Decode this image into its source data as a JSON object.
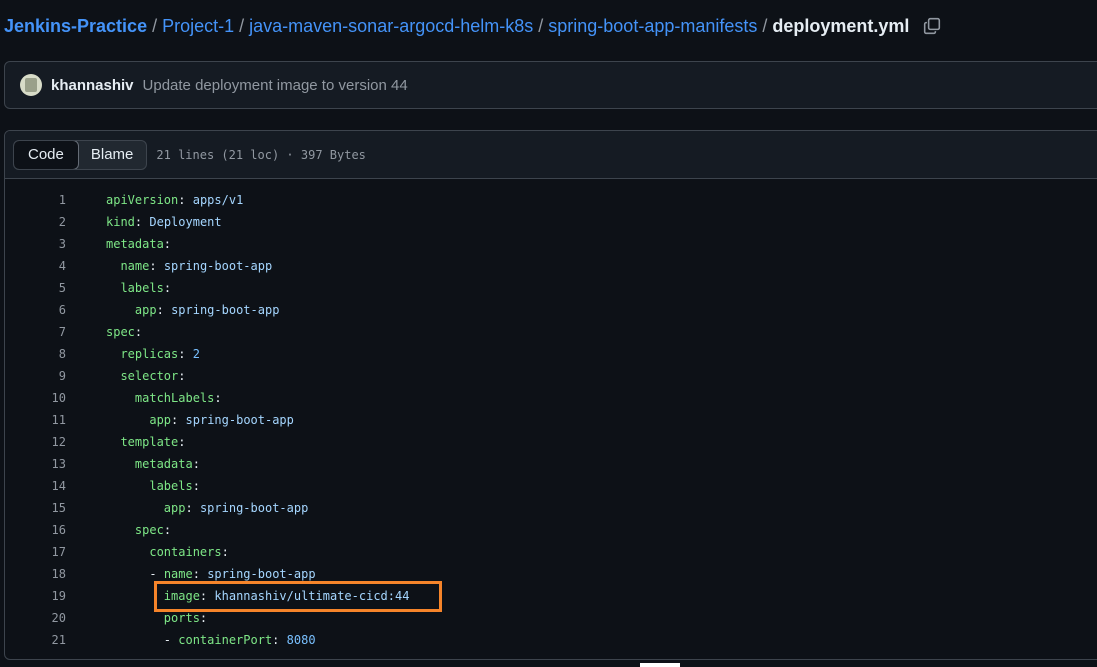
{
  "breadcrumb": {
    "repo": "Jenkins-Practice",
    "path": [
      "Project-1",
      "java-maven-sonar-argocd-helm-k8s",
      "spring-boot-app-manifests"
    ],
    "current": "deployment.yml",
    "copy_icon": "copy-icon"
  },
  "commit": {
    "author": "khannashiv",
    "message": "Update deployment image to version 44"
  },
  "file": {
    "tabs": [
      "Code",
      "Blame"
    ],
    "active_tab": "Code",
    "info": "21 lines (21 loc) · 397 Bytes"
  },
  "code_lines": [
    {
      "n": "1",
      "indent": "",
      "key": "apiVersion",
      "value": "apps/v1",
      "dash": false
    },
    {
      "n": "2",
      "indent": "",
      "key": "kind",
      "value": "Deployment",
      "dash": false
    },
    {
      "n": "3",
      "indent": "",
      "key": "metadata",
      "value": "",
      "dash": false
    },
    {
      "n": "4",
      "indent": "  ",
      "key": "name",
      "value": "spring-boot-app",
      "dash": false
    },
    {
      "n": "5",
      "indent": "  ",
      "key": "labels",
      "value": "",
      "dash": false
    },
    {
      "n": "6",
      "indent": "    ",
      "key": "app",
      "value": "spring-boot-app",
      "dash": false
    },
    {
      "n": "7",
      "indent": "",
      "key": "spec",
      "value": "",
      "dash": false
    },
    {
      "n": "8",
      "indent": "  ",
      "key": "replicas",
      "value": "2",
      "dash": false,
      "numeric": true
    },
    {
      "n": "9",
      "indent": "  ",
      "key": "selector",
      "value": "",
      "dash": false
    },
    {
      "n": "10",
      "indent": "    ",
      "key": "matchLabels",
      "value": "",
      "dash": false
    },
    {
      "n": "11",
      "indent": "      ",
      "key": "app",
      "value": "spring-boot-app",
      "dash": false
    },
    {
      "n": "12",
      "indent": "  ",
      "key": "template",
      "value": "",
      "dash": false
    },
    {
      "n": "13",
      "indent": "    ",
      "key": "metadata",
      "value": "",
      "dash": false
    },
    {
      "n": "14",
      "indent": "      ",
      "key": "labels",
      "value": "",
      "dash": false
    },
    {
      "n": "15",
      "indent": "        ",
      "key": "app",
      "value": "spring-boot-app",
      "dash": false
    },
    {
      "n": "16",
      "indent": "    ",
      "key": "spec",
      "value": "",
      "dash": false
    },
    {
      "n": "17",
      "indent": "      ",
      "key": "containers",
      "value": "",
      "dash": false
    },
    {
      "n": "18",
      "indent": "      ",
      "key": "name",
      "value": "spring-boot-app",
      "dash": true
    },
    {
      "n": "19",
      "indent": "        ",
      "key": "image",
      "value": "khannashiv/ultimate-cicd:44",
      "dash": false
    },
    {
      "n": "20",
      "indent": "        ",
      "key": "ports",
      "value": "",
      "dash": false
    },
    {
      "n": "21",
      "indent": "        ",
      "key": "containerPort",
      "value": "8080",
      "dash": true,
      "numeric": true
    }
  ],
  "colors": {
    "background": "#0d1117",
    "link": "#4493f8",
    "yaml_key": "#7ee787",
    "yaml_value": "#a5d6ff",
    "highlight_border": "#f5842a"
  }
}
